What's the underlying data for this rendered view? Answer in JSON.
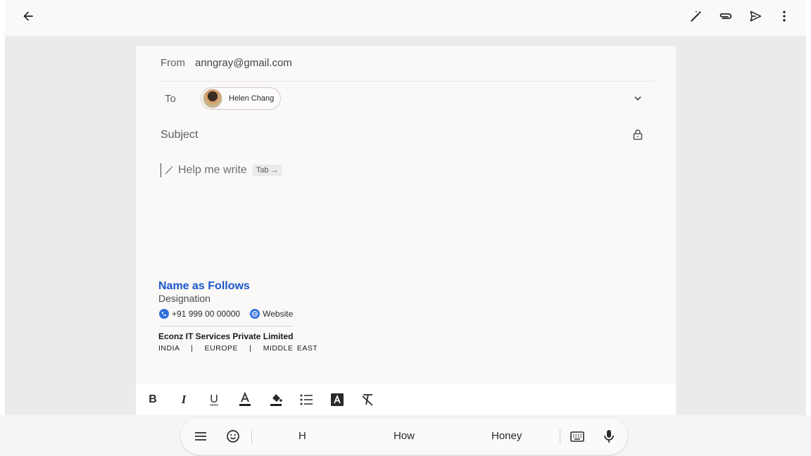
{
  "toolbar": {
    "back_icon": "arrow-left-icon",
    "icons": [
      "magic-pen-icon",
      "attach-icon",
      "send-icon",
      "more-vert-icon"
    ]
  },
  "compose": {
    "from_label": "From",
    "from_value": "anngray@gmail.com",
    "to_label": "To",
    "recipient_name": "Helen Chang",
    "subject_placeholder": "Subject",
    "help_me_write": "Help me write",
    "tab_hint": "Tab →"
  },
  "signature": {
    "name": "Name as Follows",
    "designation": "Designation",
    "phone": "+91 999 00 00000",
    "website": "Website",
    "company": "Econz IT Services Private Limited",
    "regions": "INDIA   |   EUROPE   |   MIDDLE EAST",
    "accent_color": "#1a56c9"
  },
  "format_toolbar": [
    "bold",
    "italic",
    "underline",
    "text-color",
    "highlight",
    "bulleted-list",
    "text-style",
    "clear-format"
  ],
  "keyboard": {
    "suggestions": [
      "H",
      "How",
      "Honey"
    ]
  }
}
